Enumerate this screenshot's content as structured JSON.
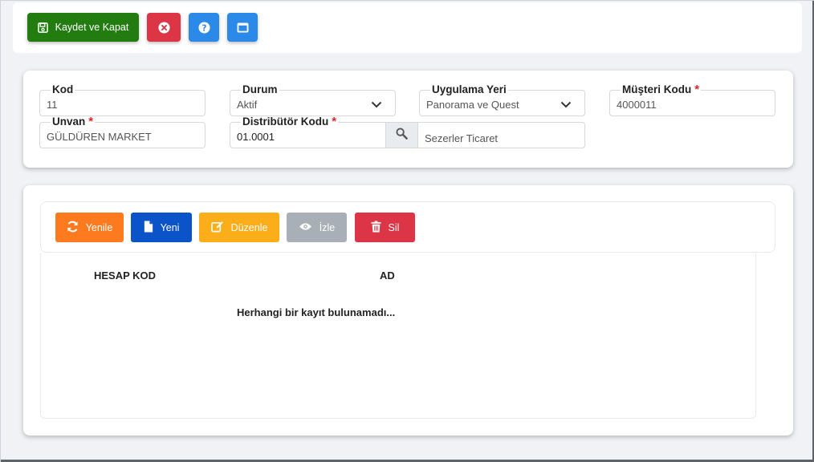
{
  "toolbar": {
    "save_label": "Kaydet ve Kapat",
    "save_icon": "floppy-disk-icon",
    "close_icon": "close-circle-icon",
    "help_icon": "question-circle-icon",
    "window_icon": "window-icon"
  },
  "form": {
    "kod": {
      "label": "Kod",
      "value": "11"
    },
    "durum": {
      "label": "Durum",
      "value": "Aktif"
    },
    "uygulama_yeri": {
      "label": "Uygulama Yeri",
      "value": "Panorama ve Quest"
    },
    "musteri_kodu": {
      "label": "Müşteri Kodu",
      "required": "*",
      "value": "4000011"
    },
    "unvan": {
      "label": "Unvan",
      "required": "*",
      "value": "GÜLDÜREN MARKET"
    },
    "distributor_kodu": {
      "label": "Distribütör Kodu",
      "required": "*",
      "value": "01.0001"
    },
    "distributor_adi": "Sezerler Ticaret"
  },
  "grid": {
    "buttons": {
      "refresh": "Yenile",
      "new": "Yeni",
      "edit": "Düzenle",
      "view": "İzle",
      "delete": "Sil"
    },
    "columns": [
      "HESAP KOD",
      "AD"
    ],
    "empty_message": "Herhangi bir kayıt bulunamadı..."
  },
  "colors": {
    "save": "#237c10",
    "close": "#dc3545",
    "help": "#2b89e8",
    "refresh": "#fd7a1e",
    "new": "#0a53c9",
    "edit": "#fbad1a",
    "view": "#a9afb6",
    "delete": "#dc3545"
  }
}
